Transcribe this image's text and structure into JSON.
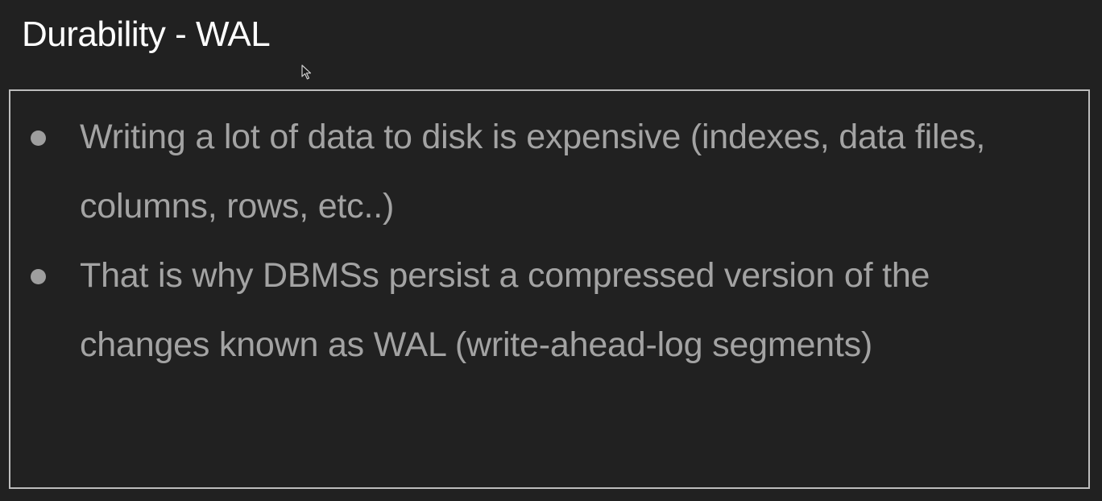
{
  "slide": {
    "title": "Durability - WAL",
    "bullets": [
      {
        "text": "Writing a lot of data to disk is expensive (indexes, data files, columns, rows, etc..)"
      },
      {
        "text": "That is why DBMSs persist a compressed version of the changes known as WAL (write-ahead-log segments)"
      }
    ]
  },
  "colors": {
    "background": "#212121",
    "title": "#ffffff",
    "body_text": "#a3a3a3",
    "border": "#bdbdbd"
  },
  "icons": {
    "cursor": "mouse-pointer-icon",
    "bullet": "bullet-dot-icon"
  }
}
